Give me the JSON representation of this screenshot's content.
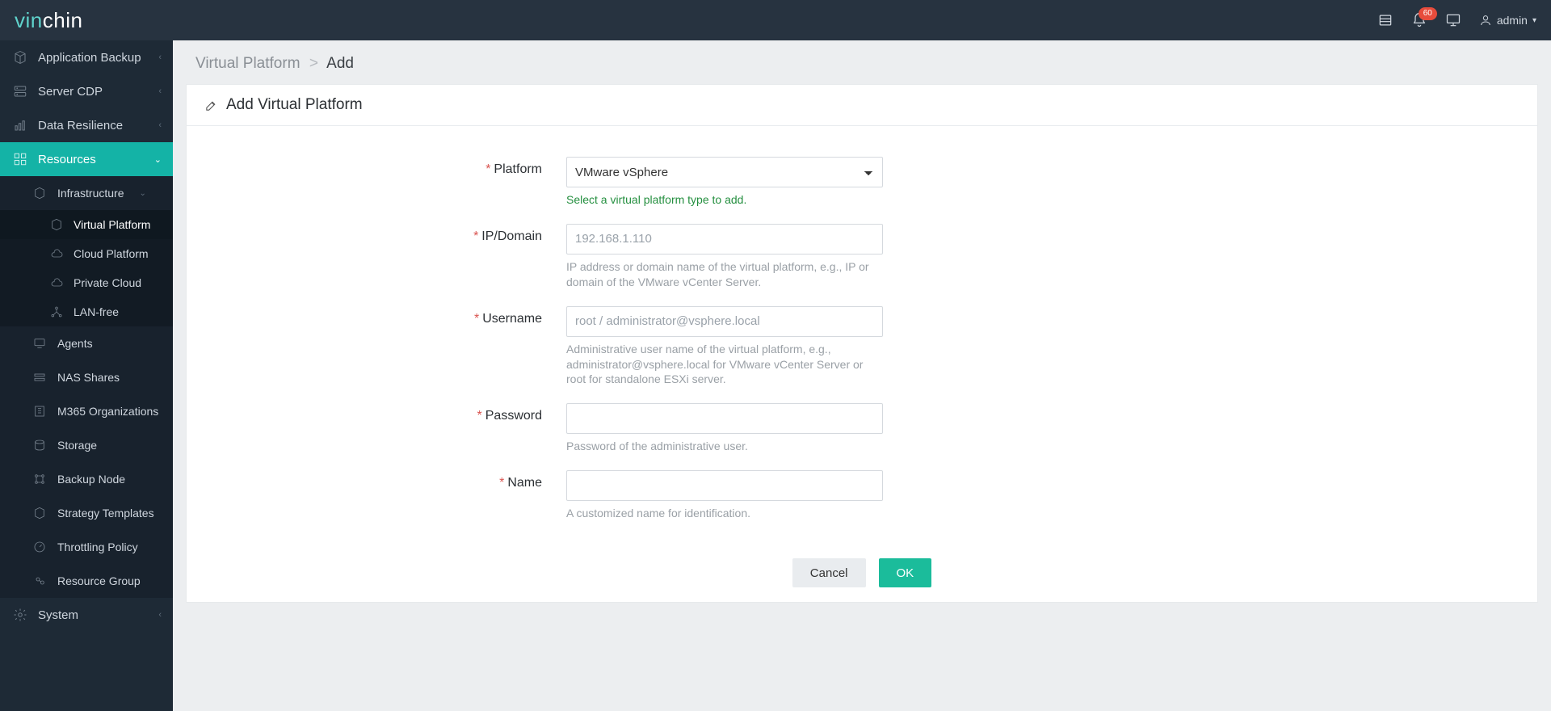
{
  "header": {
    "logo_a": "vin",
    "logo_b": "chin",
    "badge": "60",
    "user": "admin"
  },
  "sidebar": {
    "app_backup": "Application Backup",
    "server_cdp": "Server CDP",
    "data_resilience": "Data Resilience",
    "resources": "Resources",
    "infrastructure": "Infrastructure",
    "virtual_platform": "Virtual Platform",
    "cloud_platform": "Cloud Platform",
    "private_cloud": "Private Cloud",
    "lan_free": "LAN-free",
    "agents": "Agents",
    "nas_shares": "NAS Shares",
    "m365": "M365 Organizations",
    "storage": "Storage",
    "backup_node": "Backup Node",
    "strategy": "Strategy Templates",
    "throttling": "Throttling Policy",
    "resource_group": "Resource Group",
    "system": "System"
  },
  "crumbs": {
    "a": "Virtual Platform",
    "b": "Add"
  },
  "panel": {
    "title": "Add Virtual Platform"
  },
  "form": {
    "platform_label": "Platform",
    "platform_value": "VMware vSphere",
    "platform_help": "Select a virtual platform type to add.",
    "ip_label": "IP/Domain",
    "ip_placeholder": "192.168.1.110",
    "ip_help": "IP address or domain name of the virtual platform, e.g., IP or domain of the VMware vCenter Server.",
    "user_label": "Username",
    "user_placeholder": "root / administrator@vsphere.local",
    "user_help": "Administrative user name of the virtual platform, e.g., administrator@vsphere.local for VMware vCenter Server or root for standalone ESXi server.",
    "pwd_label": "Password",
    "pwd_help": "Password of the administrative user.",
    "name_label": "Name",
    "name_help": "A customized name for identification."
  },
  "buttons": {
    "cancel": "Cancel",
    "ok": "OK"
  }
}
